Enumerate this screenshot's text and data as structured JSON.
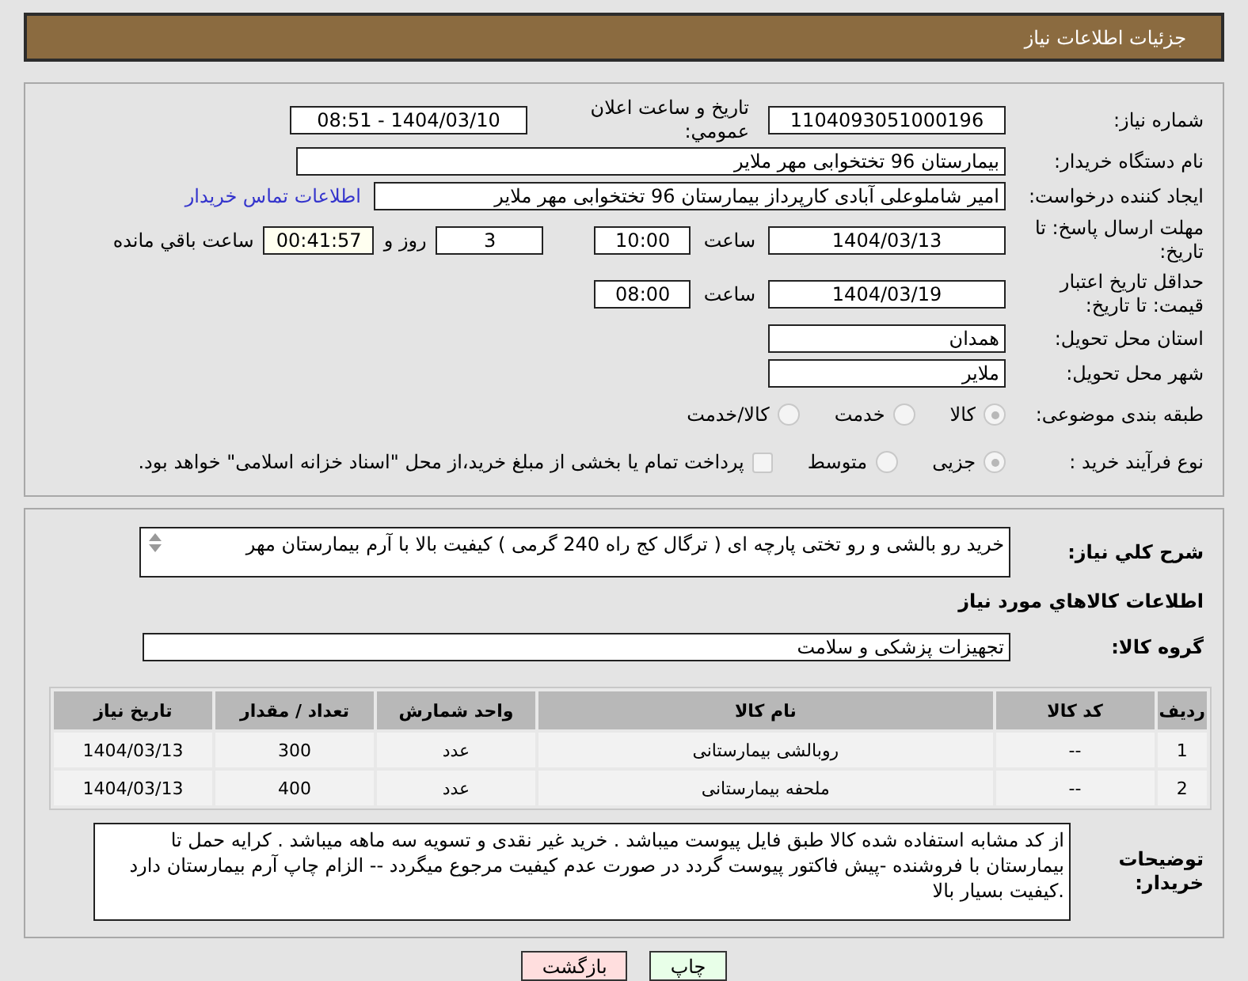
{
  "header": {
    "title": "جزئیات اطلاعات نیاز"
  },
  "need_number": {
    "label": "شماره نیاز:",
    "value": "1104093051000196"
  },
  "announce": {
    "label": "تاریخ و ساعت اعلان عمومي:",
    "value": "1404/03/10 - 08:51"
  },
  "buyer_org": {
    "label": "نام دستگاه خریدار:",
    "value": "بیمارستان 96 تختخوابی مهر ملایر"
  },
  "requester": {
    "label": "ایجاد کننده درخواست:",
    "value": "امیر شاملوعلی آبادی کارپرداز بیمارستان 96 تختخوابی مهر ملایر",
    "contact_link": "اطلاعات تماس خریدار"
  },
  "deadline": {
    "label": "مهلت ارسال پاسخ: تا تاریخ:",
    "date": "1404/03/13",
    "time_label": "ساعت",
    "time": "10:00",
    "days": "3",
    "days_label": "روز و",
    "remaining": "00:41:57",
    "remaining_label": "ساعت باقي مانده"
  },
  "price_validity": {
    "label": "حداقل تاریخ اعتبار قیمت: تا تاریخ:",
    "date": "1404/03/19",
    "time_label": "ساعت",
    "time": "08:00"
  },
  "province": {
    "label": "استان محل تحویل:",
    "value": "همدان"
  },
  "city": {
    "label": "شهر محل تحویل:",
    "value": "ملایر"
  },
  "category": {
    "label": "طبقه بندی موضوعی:",
    "options": [
      {
        "label": "کالا",
        "selected": true
      },
      {
        "label": "خدمت",
        "selected": false
      },
      {
        "label": "کالا/خدمت",
        "selected": false
      }
    ]
  },
  "process": {
    "label": "نوع فرآیند خرید :",
    "options": [
      {
        "label": "جزیی",
        "selected": true
      },
      {
        "label": "متوسط",
        "selected": false
      }
    ],
    "treasury": {
      "checked": false,
      "text": "پرداخت تمام یا بخشی از مبلغ خرید،از محل \"اسناد خزانه اسلامی\" خواهد بود."
    }
  },
  "description": {
    "label": "شرح کلي نیاز:",
    "value": "خرید رو بالشی و رو تختی  پارچه ای  ( ترگال کج راه  240 گرمی  )  کیفیت بالا  با آرم بیمارستان مهر"
  },
  "goods_title": "اطلاعات کالاهاي مورد نیاز",
  "goods_group": {
    "label": "گروه کالا:",
    "value": "تجهیزات پزشکی و سلامت"
  },
  "table": {
    "columns": [
      "ردیف",
      "کد کالا",
      "نام کالا",
      "واحد شمارش",
      "تعداد / مقدار",
      "تاریخ نیاز"
    ],
    "rows": [
      [
        "1",
        "--",
        "روبالشی بیمارستانی",
        "عدد",
        "300",
        "1404/03/13"
      ],
      [
        "2",
        "--",
        "ملحفه بیمارستانی",
        "عدد",
        "400",
        "1404/03/13"
      ]
    ]
  },
  "buyer_notes": {
    "label": "توضیحات خریدار:",
    "value": "از کد مشابه استفاده شده کالا طبق فایل پیوست میباشد . خرید غیر نقدی و تسویه سه ماهه میباشد .  کرایه حمل تا بیمارستان با فروشنده  -پیش فاکتور پیوست گردد  در صورت عدم کیفیت مرجوع میگردد -- الزام چاپ آرم بیمارستان دارد .کیفیت بسیار بالا"
  },
  "buttons": [
    {
      "label": "چاپ",
      "kind": "print"
    },
    {
      "label": "بازگشت",
      "kind": "back"
    }
  ]
}
